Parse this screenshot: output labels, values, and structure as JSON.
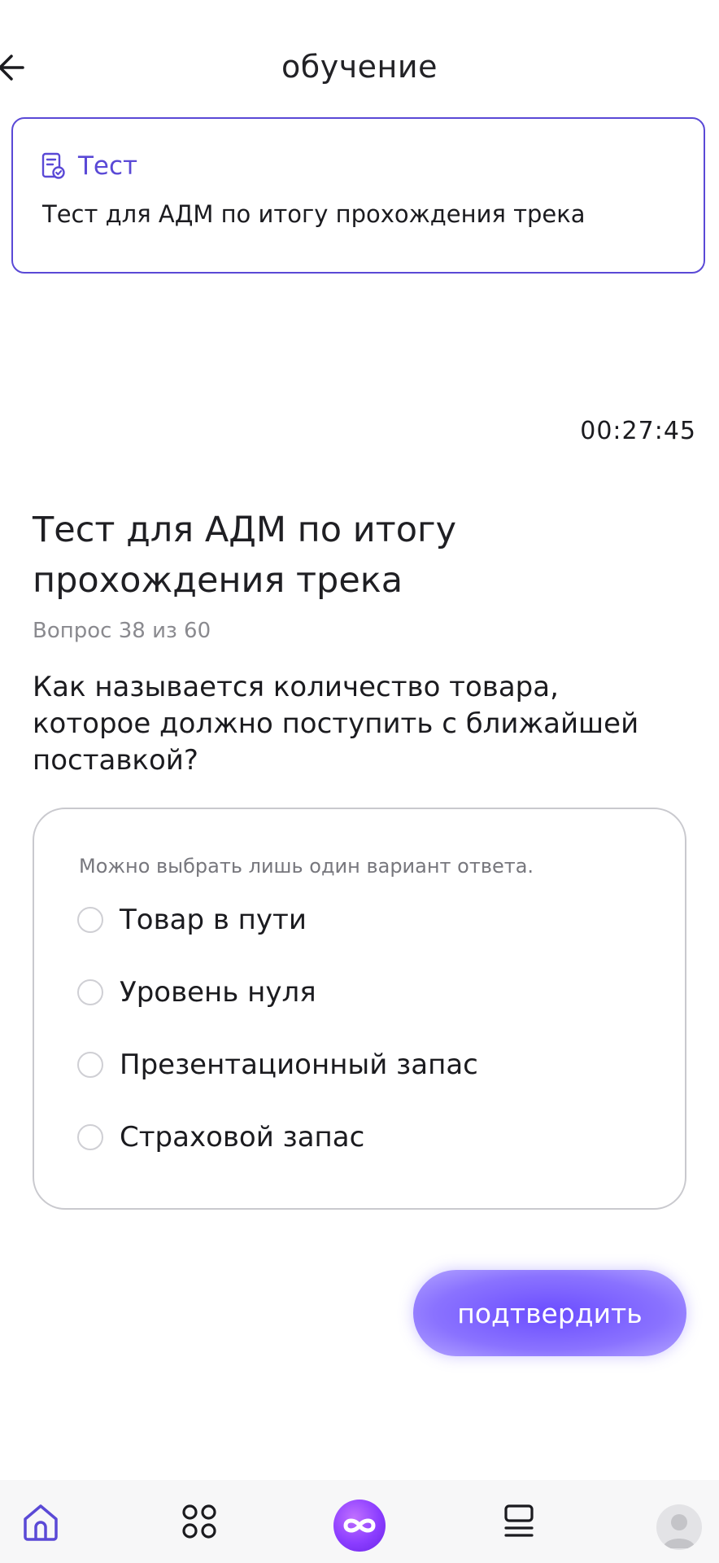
{
  "header": {
    "title": "обучение"
  },
  "test_card": {
    "type_label": "Тест",
    "name": "Тест для АДМ по итогу прохождения трека"
  },
  "timer": "00:27:45",
  "quiz": {
    "title": "Тест для АДМ по итогу прохождения трека",
    "counter": "Вопрос 38 из 60",
    "question": "Как называется количество товара, которое должно поступить с ближайшей поставкой?",
    "hint": "Можно выбрать лишь один вариант ответа.",
    "options": [
      {
        "label": "Товар в пути",
        "selected": false
      },
      {
        "label": "Уровень нуля",
        "selected": false
      },
      {
        "label": "Презентационный запас",
        "selected": false
      },
      {
        "label": "Страховой запас",
        "selected": false
      }
    ]
  },
  "confirm_button": {
    "label": "подтвердить"
  },
  "bottom_nav": {
    "items": [
      {
        "icon": "home-icon",
        "active": true
      },
      {
        "icon": "catalog-grid-icon",
        "active": false
      },
      {
        "icon": "infinity-icon",
        "active": false
      },
      {
        "icon": "library-icon",
        "active": false
      },
      {
        "icon": "profile-avatar",
        "active": false
      }
    ]
  },
  "colors": {
    "accent": "#5a49d6",
    "button_gradient_start": "#6b4dff",
    "button_gradient_end": "#b3a4ff",
    "center_badge": "#8b3dff",
    "text_primary": "#1b1b1f",
    "text_secondary": "#8a8a8f"
  }
}
